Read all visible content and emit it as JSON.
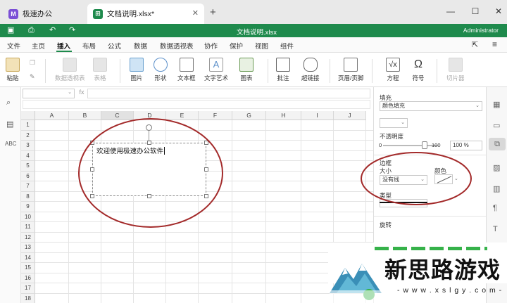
{
  "tabs": [
    {
      "label": "极速办公",
      "logo": "M"
    },
    {
      "label": "文档说明.xlsx*",
      "logo": "⊞"
    }
  ],
  "titlebar": {
    "filename": "文档说明.xlsx",
    "user": "Administrator"
  },
  "menu": [
    "文件",
    "主页",
    "插入",
    "布局",
    "公式",
    "数据",
    "数据透视表",
    "协作",
    "保护",
    "视图",
    "组件"
  ],
  "menu_active": "插入",
  "ribbon": [
    {
      "label": "粘贴"
    },
    {
      "label": "数据透视表"
    },
    {
      "label": "表格"
    },
    {
      "label": "图片"
    },
    {
      "label": "形状"
    },
    {
      "label": "文本框"
    },
    {
      "label": "文字艺术"
    },
    {
      "label": "图表"
    },
    {
      "label": "批注"
    },
    {
      "label": "超链接"
    },
    {
      "label": "页眉/页脚"
    },
    {
      "label": "方程"
    },
    {
      "label": "符号"
    },
    {
      "label": "切片器"
    }
  ],
  "formula_bar": {
    "fx": "fx"
  },
  "columns": [
    "A",
    "B",
    "C",
    "D",
    "E",
    "F",
    "G",
    "H",
    "I",
    "J"
  ],
  "rows": [
    "1",
    "2",
    "3",
    "4",
    "5",
    "6",
    "7",
    "8",
    "9",
    "10",
    "11",
    "12",
    "13",
    "14",
    "15",
    "16",
    "17",
    "18"
  ],
  "textbox": {
    "text": "欢迎使用极速办公软件"
  },
  "panel": {
    "fill_label": "填充",
    "fill_type": "颜色填充",
    "opacity_label": "不透明度",
    "opacity_min": "0",
    "opacity_max": "100",
    "opacity_value": "100 %",
    "opacity_level": 0.75,
    "border_label": "边框",
    "size_label": "大小",
    "size_value": "没有线",
    "color_label": "颜色",
    "type_label": "类型",
    "rotate_label": "旋转"
  },
  "watermark": {
    "title": "新思路游戏",
    "url": "- w w w . x s l g y . c o m -"
  }
}
